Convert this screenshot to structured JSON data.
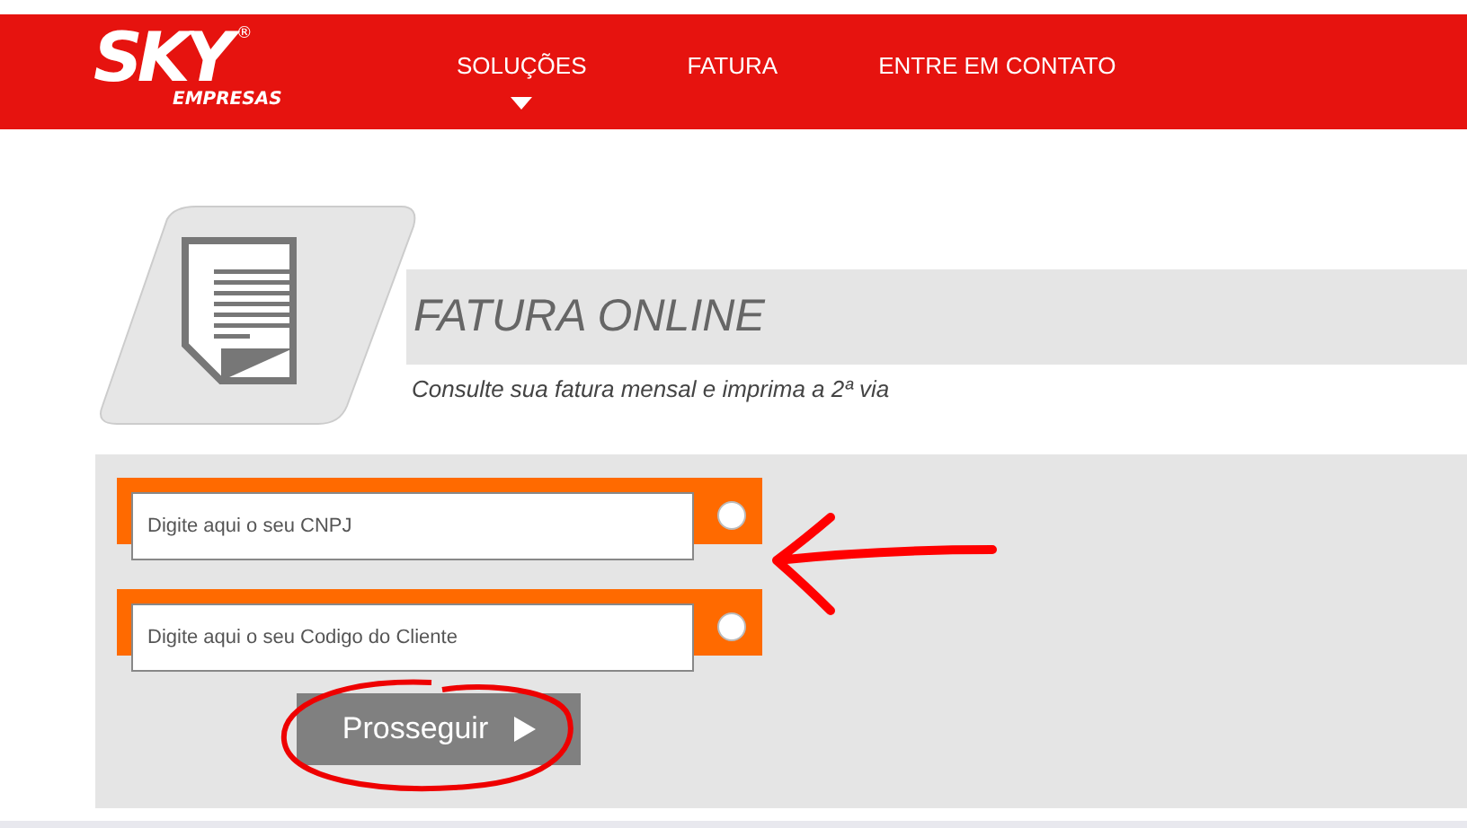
{
  "header": {
    "logo": {
      "brand": "SKY",
      "registered": "®",
      "sub": "EMPRESAS"
    },
    "nav": [
      {
        "label": "SOLUÇÕES",
        "selected": true
      },
      {
        "label": "FATURA",
        "selected": false
      },
      {
        "label": "ENTRE EM CONTATO",
        "selected": false
      }
    ]
  },
  "hero": {
    "title": "FATURA ONLINE",
    "subtitle": "Consulte sua fatura mensal e imprima a 2ª via"
  },
  "form": {
    "options": [
      {
        "placeholder": "Digite aqui o seu CNPJ",
        "selected": false
      },
      {
        "placeholder": "Digite aqui o seu Codigo do Cliente",
        "selected": false
      }
    ],
    "button": "Prosseguir"
  }
}
